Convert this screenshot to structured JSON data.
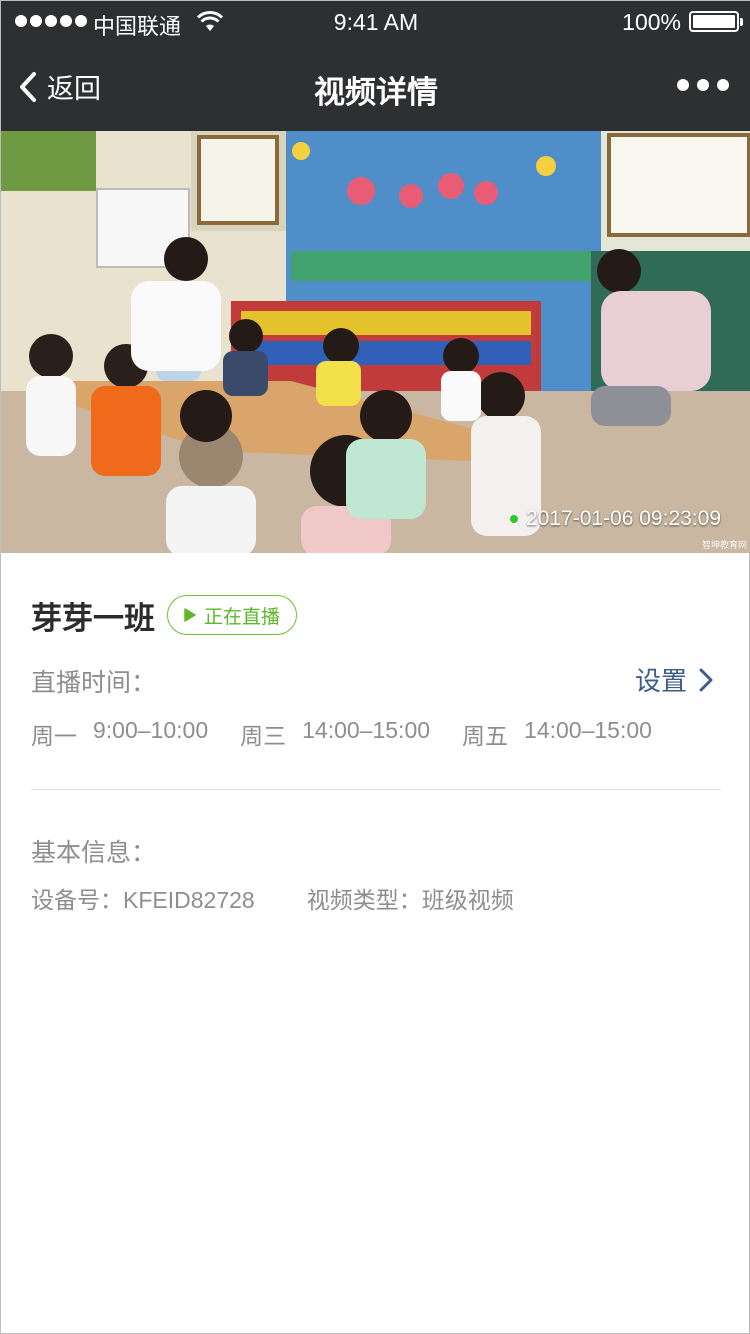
{
  "status_bar": {
    "carrier": "中国联通",
    "time": "9:41 AM",
    "battery": "100%"
  },
  "nav": {
    "back_label": "返回",
    "title": "视频详情"
  },
  "video": {
    "timestamp": "2017-01-06  09:23:09",
    "watermark": "智坤教育网",
    "live_indicator_color": "#2ec52e"
  },
  "class_info": {
    "name": "芽芽一班",
    "status_badge": "正在直播",
    "status_color": "#5cb82a"
  },
  "schedule": {
    "label": "直播时间：",
    "settings_label": "设置",
    "items": [
      {
        "day": "周一",
        "time": "9:00–10:00"
      },
      {
        "day": "周三",
        "time": "14:00–15:00"
      },
      {
        "day": "周五",
        "time": "14:00–15:00"
      }
    ]
  },
  "basic_info": {
    "label": "基本信息：",
    "device_label": "设备号：",
    "device_value": "KFEID82728",
    "type_label": "视频类型：",
    "type_value": "班级视频"
  },
  "colors": {
    "nav_bg": "#2e2f31",
    "link": "#3d5c86",
    "secondary_text": "#8e8e8e"
  },
  "icons": [
    "signal-dots-icon",
    "wifi-icon",
    "battery-icon",
    "back-chevron-icon",
    "more-dots-icon",
    "play-icon",
    "chevron-right-icon"
  ]
}
